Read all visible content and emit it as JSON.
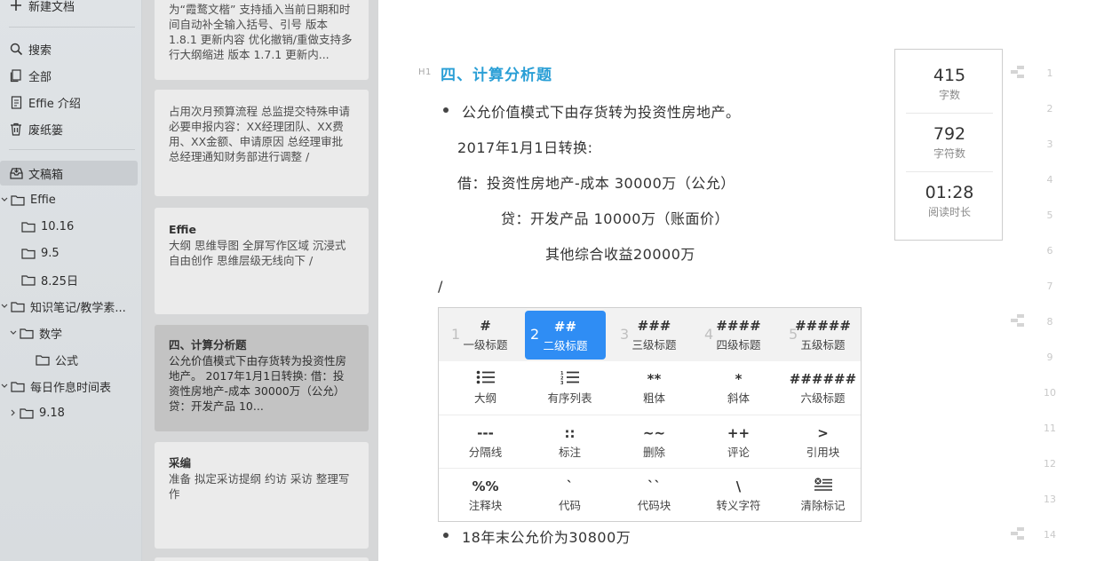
{
  "sidebar": {
    "new_doc": "新建文档",
    "search": "搜索",
    "all": "全部",
    "intro": "Effie 介绍",
    "trash": "废纸篓",
    "drafts": "文稿箱",
    "effie": "Effie",
    "f1016": "10.16",
    "f95": "9.5",
    "f825": "8.25日",
    "knowledge": "知识笔记/教学素...",
    "math": "数学",
    "formula": "公式",
    "daily": "每日作息时间表",
    "f918": "9.18"
  },
  "notes": [
    {
      "title": "",
      "body": "为“霞鹜文楷” 支持插入当前日期和时间自动补全输入括号、引号 版本 1.8.1 更新内容 优化撤销/重做支持多行大纲缩进 版本 1.7.1 更新内..."
    },
    {
      "title": "",
      "body": "占用次月预算流程 总监提交特殊申请 必要申报内容：XX经理团队、XX费用、XX金额、申请原因 总经理审批 总经理通知财务部进行调整 /"
    },
    {
      "title": "Effie",
      "body": "大纲 思维导图 全屏写作区域 沉浸式 自由创作 思维层级无线向下 /"
    },
    {
      "title": "四、计算分析题",
      "body": "公允价值模式下由存货转为投资性房地产。 2017年1月1日转换: 借：投资性房地产-成本 30000万（公允） 贷：开发产品 10..."
    },
    {
      "title": "采编",
      "body": "准备 拟定采访提纲 约访 采访 整理写作"
    }
  ],
  "editor": {
    "h1_tag": "H1",
    "heading": "四、计算分析题",
    "line1": "公允价值模式下由存货转为投资性房地产。",
    "line2": "2017年1月1日转换:",
    "line3": "借：投资性房地产-成本 30000万（公允）",
    "line4": "贷：开发产品 10000万（账面价）",
    "line5": "其他综合收益20000万",
    "slash": "/",
    "line_last": "18年末公允价为30800万"
  },
  "stats": {
    "words": "415",
    "words_label": "字数",
    "chars": "792",
    "chars_label": "字符数",
    "time": "01:28",
    "time_label": "阅读时长"
  },
  "line_numbers": [
    "1",
    "2",
    "3",
    "4",
    "5",
    "6",
    "7",
    "8",
    "9",
    "10",
    "11",
    "12",
    "13",
    "14"
  ],
  "popup": {
    "row1": [
      {
        "idx": "1",
        "sym": "#",
        "label": "一级标题"
      },
      {
        "idx": "2",
        "sym": "##",
        "label": "二级标题"
      },
      {
        "idx": "3",
        "sym": "###",
        "label": "三级标题"
      },
      {
        "idx": "4",
        "sym": "####",
        "label": "四级标题"
      },
      {
        "idx": "5",
        "sym": "#####",
        "label": "五级标题"
      }
    ],
    "row2": [
      {
        "sym": "",
        "label": "大纲",
        "icon": "outline-icon"
      },
      {
        "sym": "",
        "label": "有序列表",
        "icon": "ordered-list-icon"
      },
      {
        "sym": "**",
        "label": "粗体"
      },
      {
        "sym": "*",
        "label": "斜体"
      },
      {
        "sym": "######",
        "label": "六级标题"
      }
    ],
    "row3": [
      {
        "sym": "---",
        "label": "分隔线"
      },
      {
        "sym": "::",
        "label": "标注"
      },
      {
        "sym": "~~",
        "label": "删除"
      },
      {
        "sym": "++",
        "label": "评论"
      },
      {
        "sym": ">",
        "label": "引用块"
      }
    ],
    "row4": [
      {
        "sym": "%%",
        "label": "注释块"
      },
      {
        "sym": "`",
        "label": "代码"
      },
      {
        "sym": "``",
        "label": "代码块"
      },
      {
        "sym": "\\",
        "label": "转义字符"
      },
      {
        "sym": "",
        "label": "清除标记",
        "icon": "clear-format-icon"
      }
    ],
    "selected_index": 1,
    "accent": "#2f8df4"
  },
  "colors": {
    "heading": "#2a9fd6"
  }
}
